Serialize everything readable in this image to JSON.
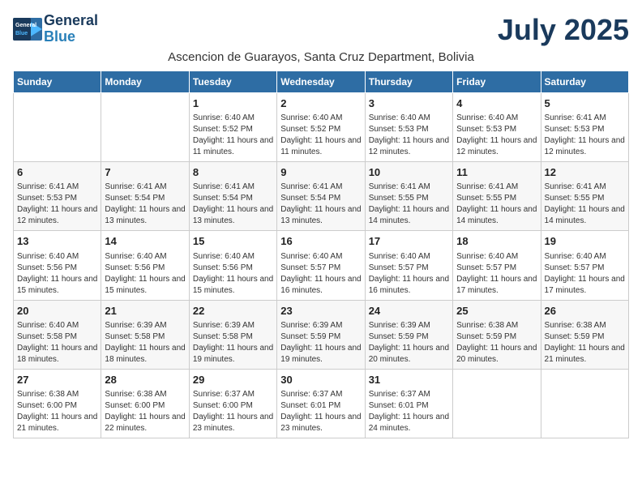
{
  "header": {
    "logo_line1": "General",
    "logo_line2": "Blue",
    "month": "July 2025",
    "location": "Ascencion de Guarayos, Santa Cruz Department, Bolivia"
  },
  "days_of_week": [
    "Sunday",
    "Monday",
    "Tuesday",
    "Wednesday",
    "Thursday",
    "Friday",
    "Saturday"
  ],
  "weeks": [
    [
      {
        "day": "",
        "info": ""
      },
      {
        "day": "",
        "info": ""
      },
      {
        "day": "1",
        "info": "Sunrise: 6:40 AM\nSunset: 5:52 PM\nDaylight: 11 hours and 11 minutes."
      },
      {
        "day": "2",
        "info": "Sunrise: 6:40 AM\nSunset: 5:52 PM\nDaylight: 11 hours and 11 minutes."
      },
      {
        "day": "3",
        "info": "Sunrise: 6:40 AM\nSunset: 5:53 PM\nDaylight: 11 hours and 12 minutes."
      },
      {
        "day": "4",
        "info": "Sunrise: 6:40 AM\nSunset: 5:53 PM\nDaylight: 11 hours and 12 minutes."
      },
      {
        "day": "5",
        "info": "Sunrise: 6:41 AM\nSunset: 5:53 PM\nDaylight: 11 hours and 12 minutes."
      }
    ],
    [
      {
        "day": "6",
        "info": "Sunrise: 6:41 AM\nSunset: 5:53 PM\nDaylight: 11 hours and 12 minutes."
      },
      {
        "day": "7",
        "info": "Sunrise: 6:41 AM\nSunset: 5:54 PM\nDaylight: 11 hours and 13 minutes."
      },
      {
        "day": "8",
        "info": "Sunrise: 6:41 AM\nSunset: 5:54 PM\nDaylight: 11 hours and 13 minutes."
      },
      {
        "day": "9",
        "info": "Sunrise: 6:41 AM\nSunset: 5:54 PM\nDaylight: 11 hours and 13 minutes."
      },
      {
        "day": "10",
        "info": "Sunrise: 6:41 AM\nSunset: 5:55 PM\nDaylight: 11 hours and 14 minutes."
      },
      {
        "day": "11",
        "info": "Sunrise: 6:41 AM\nSunset: 5:55 PM\nDaylight: 11 hours and 14 minutes."
      },
      {
        "day": "12",
        "info": "Sunrise: 6:41 AM\nSunset: 5:55 PM\nDaylight: 11 hours and 14 minutes."
      }
    ],
    [
      {
        "day": "13",
        "info": "Sunrise: 6:40 AM\nSunset: 5:56 PM\nDaylight: 11 hours and 15 minutes."
      },
      {
        "day": "14",
        "info": "Sunrise: 6:40 AM\nSunset: 5:56 PM\nDaylight: 11 hours and 15 minutes."
      },
      {
        "day": "15",
        "info": "Sunrise: 6:40 AM\nSunset: 5:56 PM\nDaylight: 11 hours and 15 minutes."
      },
      {
        "day": "16",
        "info": "Sunrise: 6:40 AM\nSunset: 5:57 PM\nDaylight: 11 hours and 16 minutes."
      },
      {
        "day": "17",
        "info": "Sunrise: 6:40 AM\nSunset: 5:57 PM\nDaylight: 11 hours and 16 minutes."
      },
      {
        "day": "18",
        "info": "Sunrise: 6:40 AM\nSunset: 5:57 PM\nDaylight: 11 hours and 17 minutes."
      },
      {
        "day": "19",
        "info": "Sunrise: 6:40 AM\nSunset: 5:57 PM\nDaylight: 11 hours and 17 minutes."
      }
    ],
    [
      {
        "day": "20",
        "info": "Sunrise: 6:40 AM\nSunset: 5:58 PM\nDaylight: 11 hours and 18 minutes."
      },
      {
        "day": "21",
        "info": "Sunrise: 6:39 AM\nSunset: 5:58 PM\nDaylight: 11 hours and 18 minutes."
      },
      {
        "day": "22",
        "info": "Sunrise: 6:39 AM\nSunset: 5:58 PM\nDaylight: 11 hours and 19 minutes."
      },
      {
        "day": "23",
        "info": "Sunrise: 6:39 AM\nSunset: 5:59 PM\nDaylight: 11 hours and 19 minutes."
      },
      {
        "day": "24",
        "info": "Sunrise: 6:39 AM\nSunset: 5:59 PM\nDaylight: 11 hours and 20 minutes."
      },
      {
        "day": "25",
        "info": "Sunrise: 6:38 AM\nSunset: 5:59 PM\nDaylight: 11 hours and 20 minutes."
      },
      {
        "day": "26",
        "info": "Sunrise: 6:38 AM\nSunset: 5:59 PM\nDaylight: 11 hours and 21 minutes."
      }
    ],
    [
      {
        "day": "27",
        "info": "Sunrise: 6:38 AM\nSunset: 6:00 PM\nDaylight: 11 hours and 21 minutes."
      },
      {
        "day": "28",
        "info": "Sunrise: 6:38 AM\nSunset: 6:00 PM\nDaylight: 11 hours and 22 minutes."
      },
      {
        "day": "29",
        "info": "Sunrise: 6:37 AM\nSunset: 6:00 PM\nDaylight: 11 hours and 23 minutes."
      },
      {
        "day": "30",
        "info": "Sunrise: 6:37 AM\nSunset: 6:01 PM\nDaylight: 11 hours and 23 minutes."
      },
      {
        "day": "31",
        "info": "Sunrise: 6:37 AM\nSunset: 6:01 PM\nDaylight: 11 hours and 24 minutes."
      },
      {
        "day": "",
        "info": ""
      },
      {
        "day": "",
        "info": ""
      }
    ]
  ]
}
